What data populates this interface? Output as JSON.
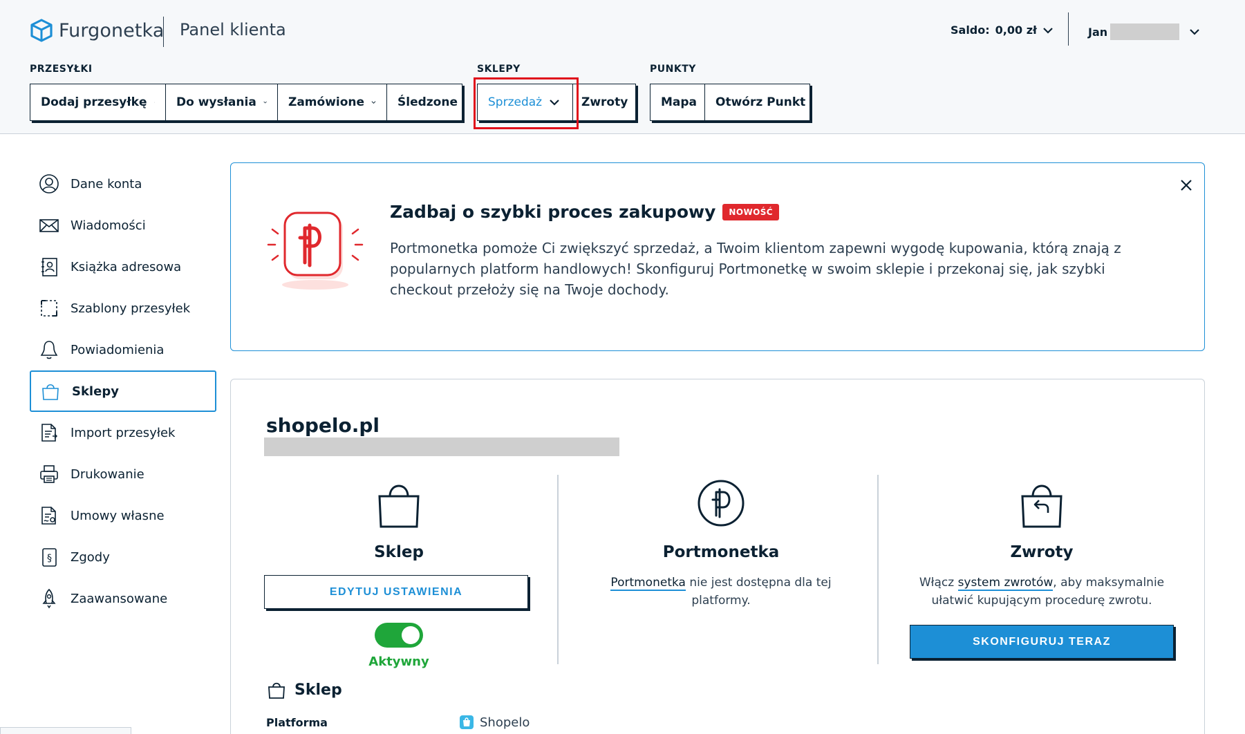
{
  "header": {
    "brand": "Furgonetka",
    "panel_title": "Panel klienta",
    "saldo_label": "Saldo:",
    "saldo_value": "0,00 zł",
    "user_name": "Jan"
  },
  "nav": {
    "groups": [
      {
        "label": "PRZESYŁKI",
        "items": [
          "Dodaj przesyłkę",
          "Do wysłania",
          "Zamówione",
          "Śledzone"
        ]
      },
      {
        "label": "SKLEPY",
        "items": [
          "Sprzedaż",
          "Zwroty"
        ]
      },
      {
        "label": "PUNKTY",
        "items": [
          "Mapa",
          "Otwórz Punkt"
        ]
      }
    ],
    "active_item": "Sprzedaż"
  },
  "sidebar": {
    "items": [
      {
        "label": "Dane konta",
        "icon": "user-circle-icon"
      },
      {
        "label": "Wiadomości",
        "icon": "envelope-icon"
      },
      {
        "label": "Książka adresowa",
        "icon": "address-book-icon"
      },
      {
        "label": "Szablony przesyłek",
        "icon": "dashed-template-icon"
      },
      {
        "label": "Powiadomienia",
        "icon": "bell-icon"
      },
      {
        "label": "Sklepy",
        "icon": "shopping-bag-icon"
      },
      {
        "label": "Import przesyłek",
        "icon": "import-document-icon"
      },
      {
        "label": "Drukowanie",
        "icon": "printer-icon"
      },
      {
        "label": "Umowy własne",
        "icon": "contract-icon"
      },
      {
        "label": "Zgody",
        "icon": "consent-document-icon"
      },
      {
        "label": "Zaawansowane",
        "icon": "rocket-icon"
      }
    ],
    "active": "Sklepy"
  },
  "banner": {
    "title": "Zadbaj o szybki proces zakupowy",
    "badge": "NOWOŚĆ",
    "text": "Portmonetka pomoże Ci zwiększyć sprzedaż, a Twoim klientom zapewni wygodę kupowania, którą znają z popularnych platform handlowych! Skonfiguruj Portmonetkę w swoim sklepie i przekonaj się, jak szybki checkout przełoży się na Twoje dochody."
  },
  "shop": {
    "name": "shopelo.pl",
    "columns": {
      "sklep": {
        "title": "Sklep",
        "button": "EDYTUJ USTAWIENIA",
        "toggle_state": "on",
        "status": "Aktywny"
      },
      "portmonetka": {
        "title": "Portmonetka",
        "link": "Portmonetka",
        "text": " nie jest dostępna dla tej platformy."
      },
      "zwroty": {
        "title": "Zwroty",
        "text_before": "Włącz ",
        "link": "system zwrotów",
        "text_after": ", aby maksymalnie ułatwić kupującym procedurę zwrotu.",
        "button": "SKONFIGURUJ TERAZ"
      }
    },
    "details": {
      "section_title": "Sklep",
      "platform_label": "Platforma",
      "platform_value": "Shopelo"
    }
  },
  "colors": {
    "accent": "#1d8fd6",
    "text": "#0b2132",
    "badge": "#e0282d",
    "success": "#1fa63a",
    "highlight": "#e0101b"
  }
}
